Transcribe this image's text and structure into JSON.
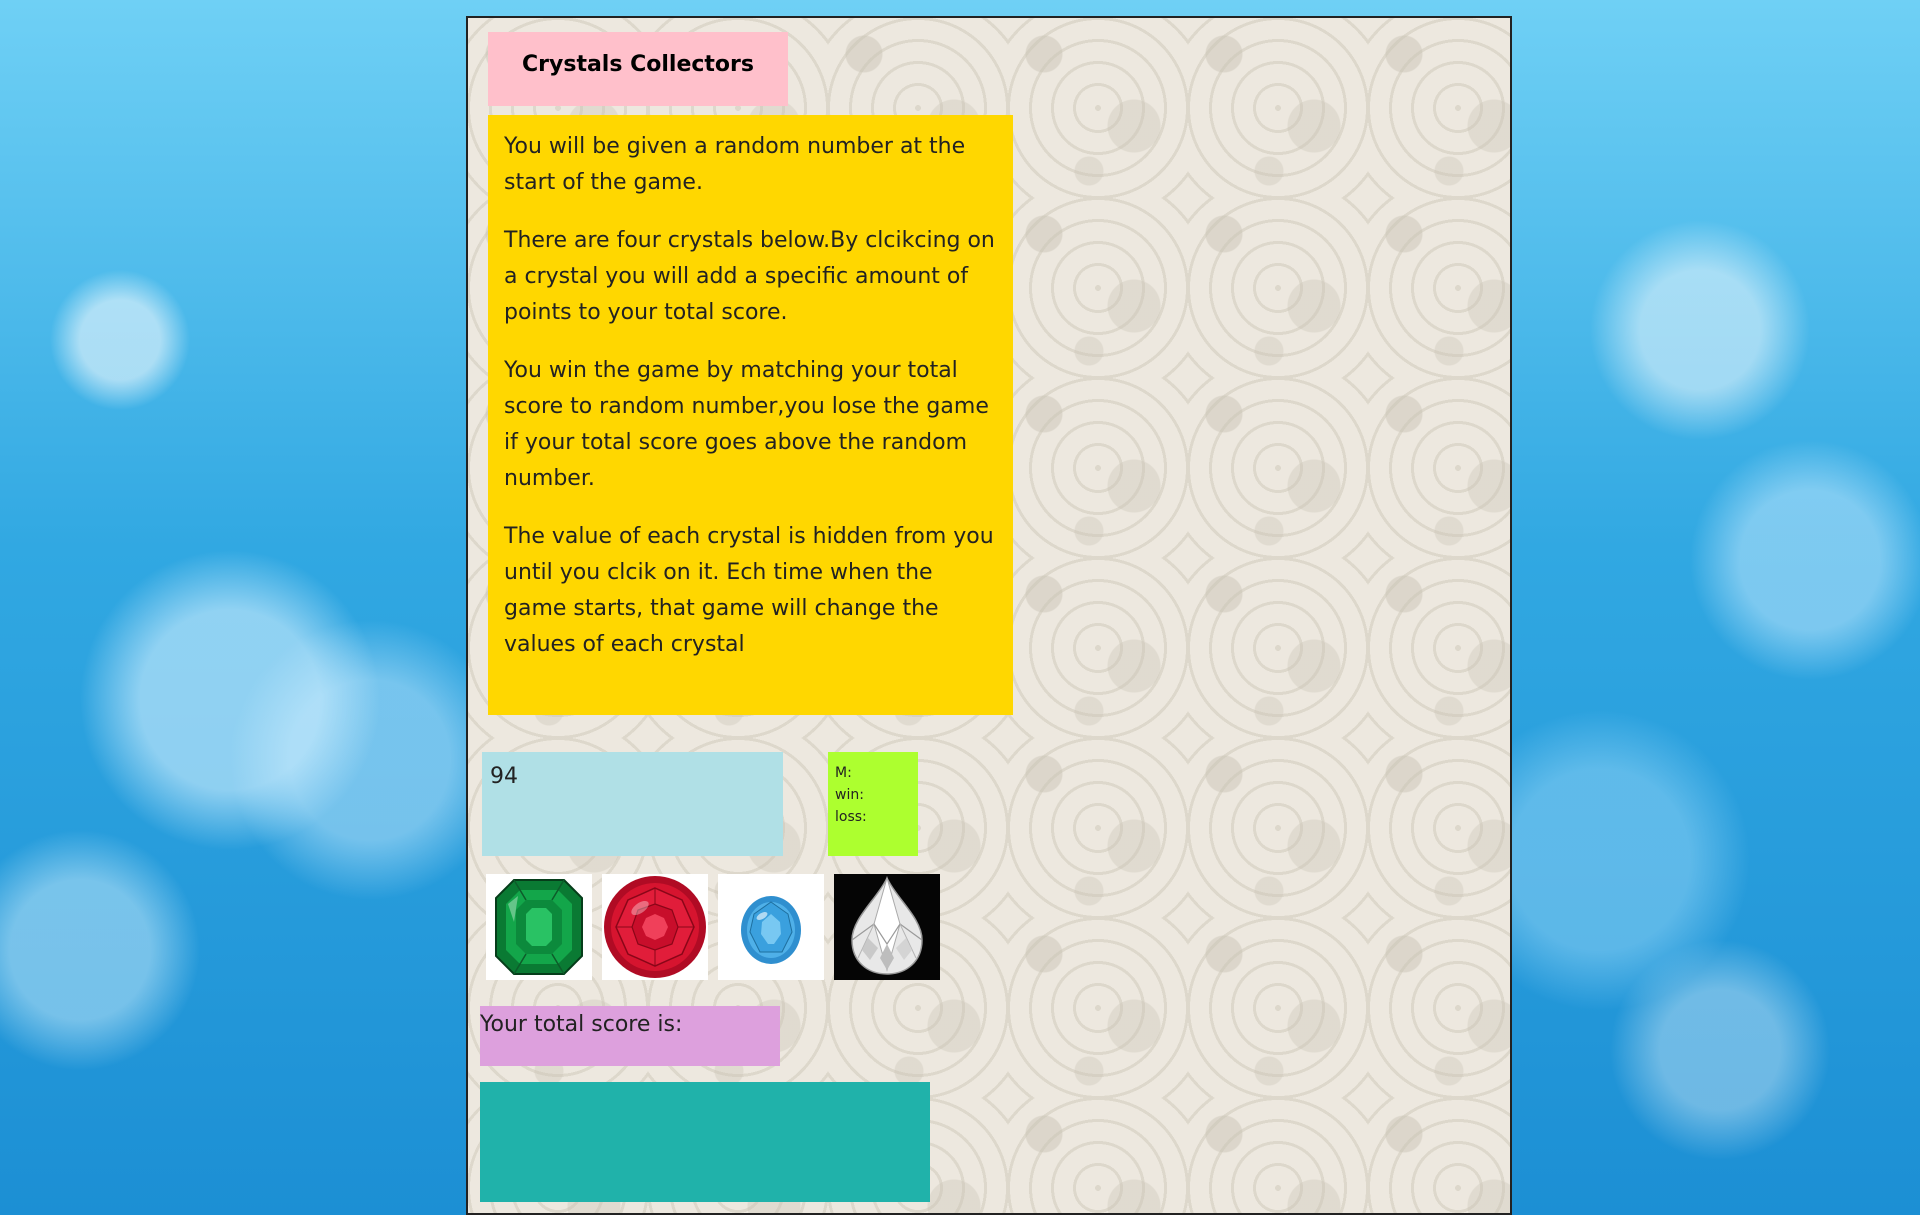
{
  "game": {
    "title": "Crystals Collectors",
    "instructions": [
      "You will be given a random number at the start of the game.",
      "There are four crystals below.By clcikcing on a crystal you will add a specific amount of points to your total score.",
      "You win the game by matching your total score to random number,you lose the game if your total score goes above the random number.",
      "The value of each crystal is hidden from you until you clcik on it. Ech time when the game starts, that game will change the values of each crystal"
    ],
    "random_number": "94",
    "stats": {
      "m_label": "M:",
      "win_label": "win:",
      "loss_label": "loss:"
    },
    "crystals": [
      {
        "name": "emerald-crystal",
        "color": "#0b8a3a"
      },
      {
        "name": "ruby-crystal",
        "color": "#c8102e"
      },
      {
        "name": "sapphire-crystal",
        "color": "#3aa0de"
      },
      {
        "name": "diamond-crystal",
        "color": "#e8e8e8"
      }
    ],
    "score_label": "Your total score is:",
    "result_text": ""
  },
  "colors": {
    "title_bg": "#ffc0cb",
    "instructions_bg": "#ffd700",
    "random_bg": "#b0e0e6",
    "stats_bg": "#adff2f",
    "score_bg": "#dda0dd",
    "result_bg": "#20b2aa"
  }
}
